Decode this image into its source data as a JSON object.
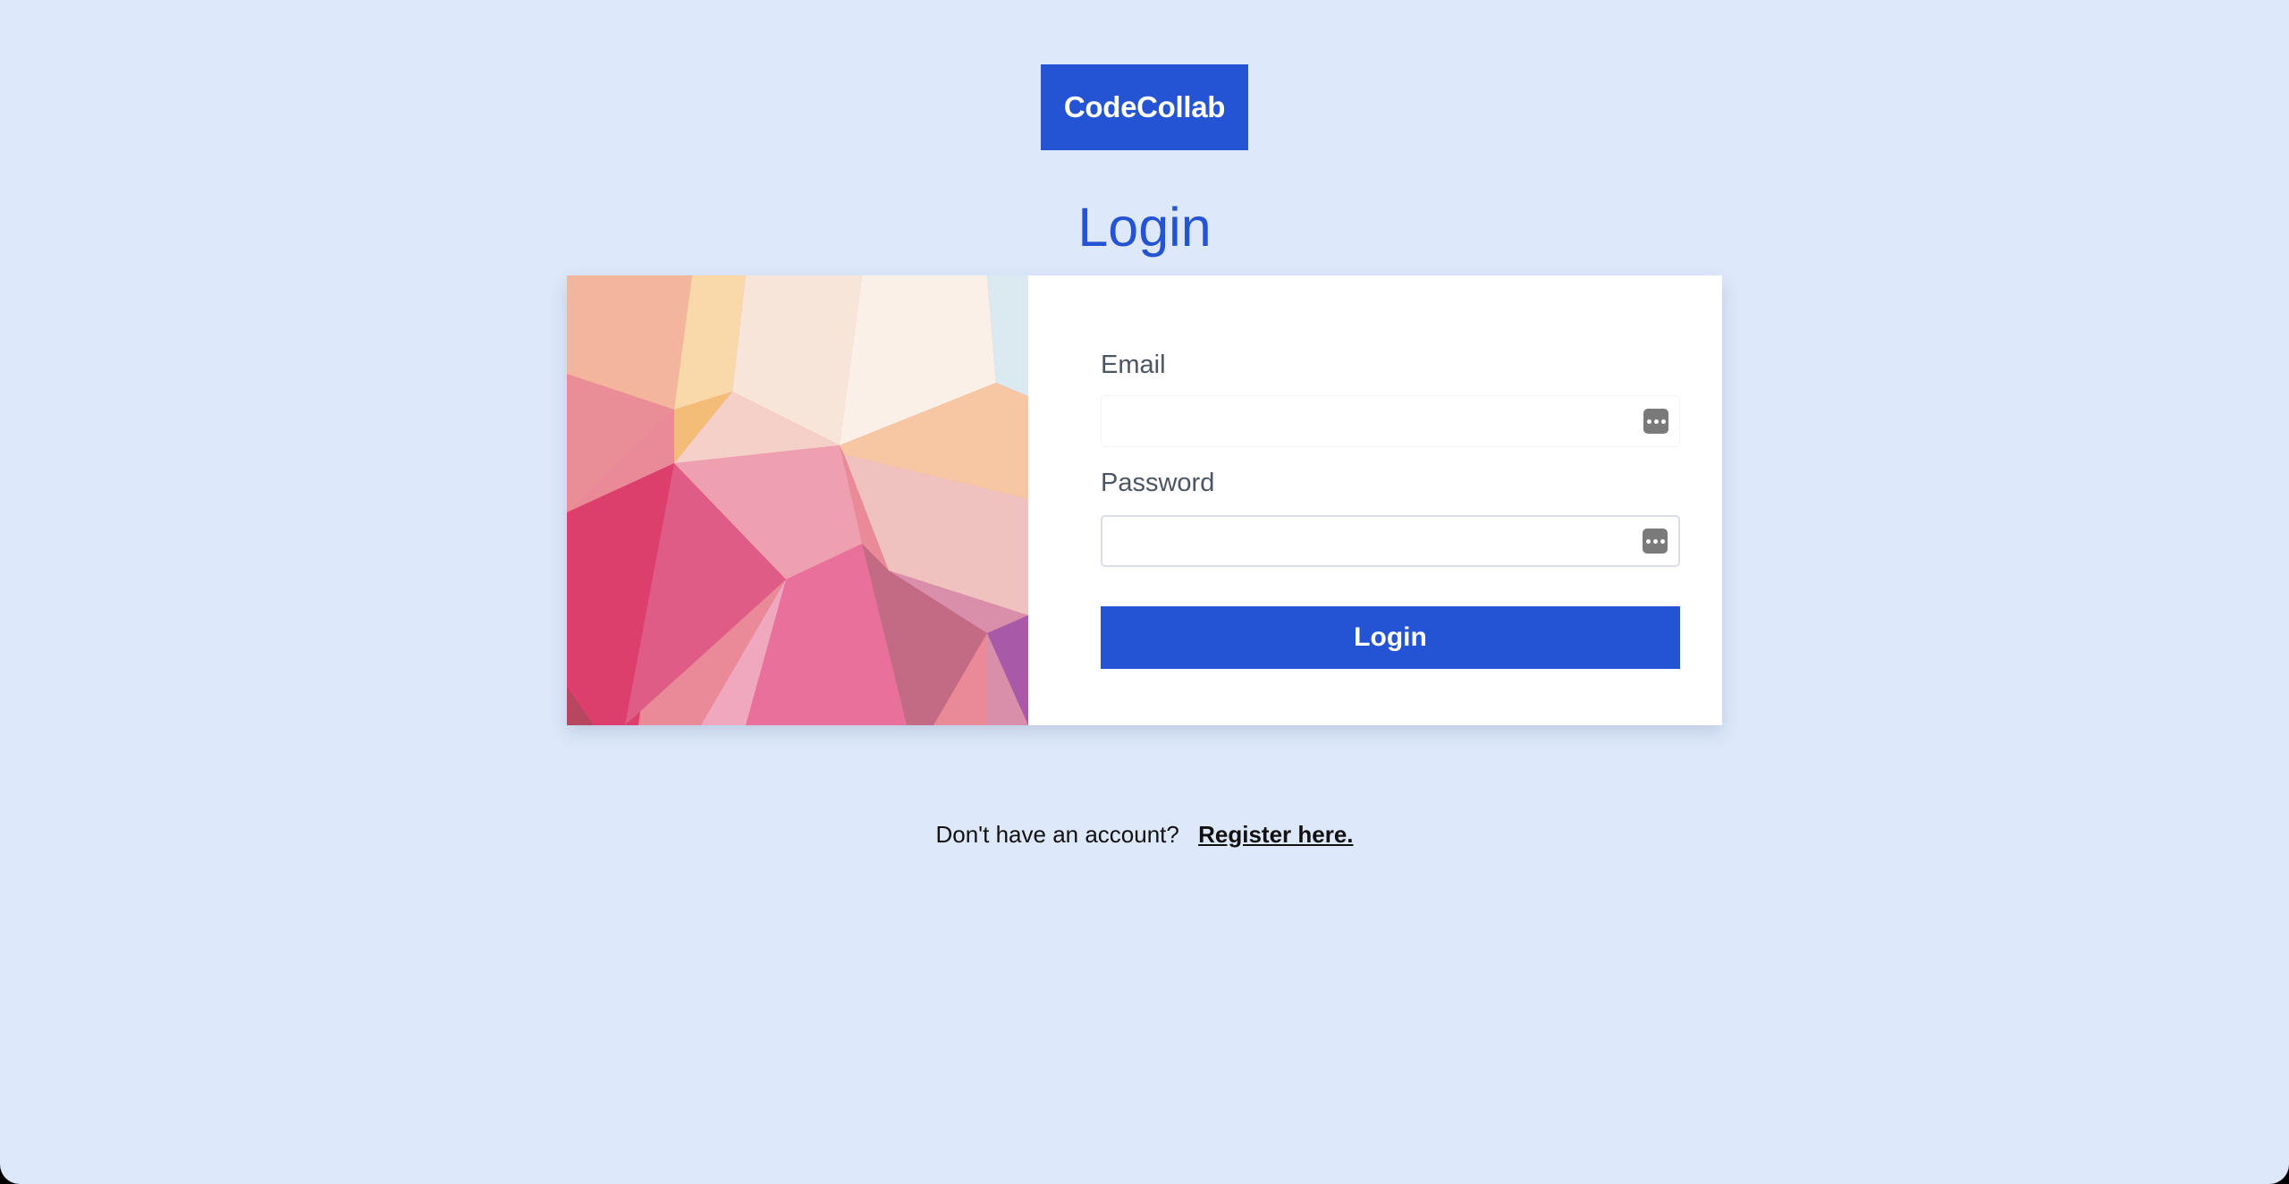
{
  "brand": {
    "name": "CodeCollab"
  },
  "page": {
    "title": "Login"
  },
  "form": {
    "email_label": "Email",
    "email_value": "",
    "password_label": "Password",
    "password_value": "",
    "submit_label": "Login",
    "field_icon": "password-manager-icon"
  },
  "footer": {
    "prompt": "Don't have an account?",
    "register_link": "Register here."
  },
  "colors": {
    "background": "#dde8fa",
    "accent": "#2453d4",
    "card": "#ffffff",
    "label": "#4b5563"
  }
}
